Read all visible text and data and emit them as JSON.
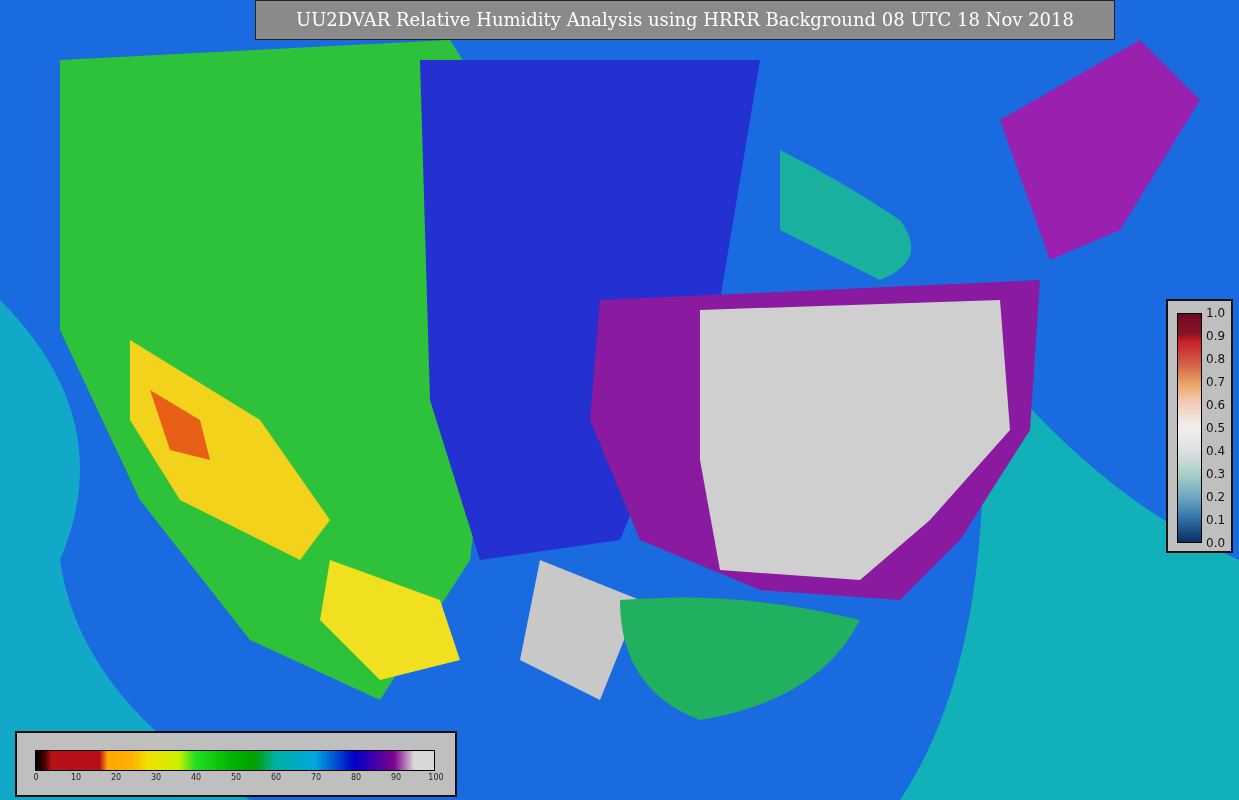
{
  "title": "UU2DVAR Relative Humidity Analysis using HRRR Background 08 UTC 18 Nov 2018",
  "humidity_colorbar": {
    "ticks": [
      "0",
      "10",
      "20",
      "30",
      "40",
      "50",
      "60",
      "70",
      "80",
      "90",
      "100"
    ]
  },
  "ratio_colorbar": {
    "ticks": [
      "1.0",
      "0.9",
      "0.8",
      "0.7",
      "0.6",
      "0.5",
      "0.4",
      "0.3",
      "0.2",
      "0.1",
      "0.0"
    ]
  }
}
